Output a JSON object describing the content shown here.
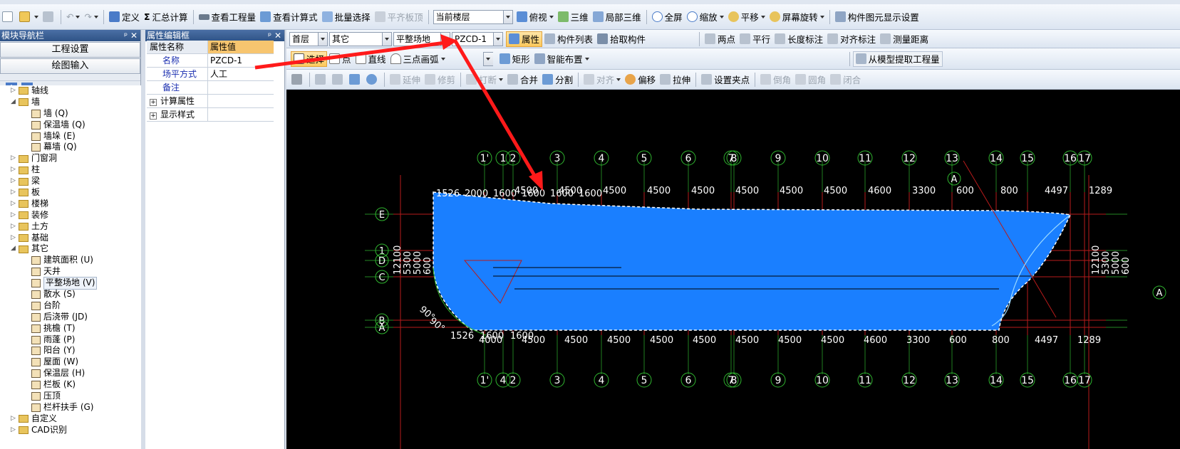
{
  "toolbar1": {
    "define": "定义",
    "summary_calc": "汇总计算",
    "view_quantity": "查看工程量",
    "view_formula": "查看计算式",
    "batch_select": "批量选择",
    "align_slab": "平齐板顶",
    "current_floor": "当前楼层",
    "top_view": "俯视",
    "three_d": "三维",
    "partial_3d": "局部三维",
    "full_screen": "全屏",
    "zoom": "缩放",
    "pan": "平移",
    "rotate_screen": "屏幕旋转",
    "display_settings": "构件图元显示设置"
  },
  "nav_panel": {
    "title": "模块导航栏",
    "project_settings": "工程设置",
    "drawing_input": "绘图输入",
    "tree": [
      {
        "label": "轴线",
        "level": 0,
        "expanded": false
      },
      {
        "label": "墙",
        "level": 0,
        "expanded": true
      },
      {
        "label": "墙 (Q)",
        "level": 1
      },
      {
        "label": "保温墙 (Q)",
        "level": 1
      },
      {
        "label": "墙垛 (E)",
        "level": 1
      },
      {
        "label": "幕墙 (Q)",
        "level": 1
      },
      {
        "label": "门窗洞",
        "level": 0,
        "expanded": false
      },
      {
        "label": "柱",
        "level": 0,
        "expanded": false
      },
      {
        "label": "梁",
        "level": 0,
        "expanded": false
      },
      {
        "label": "板",
        "level": 0,
        "expanded": false
      },
      {
        "label": "楼梯",
        "level": 0,
        "expanded": false
      },
      {
        "label": "装修",
        "level": 0,
        "expanded": false
      },
      {
        "label": "土方",
        "level": 0,
        "expanded": false
      },
      {
        "label": "基础",
        "level": 0,
        "expanded": false
      },
      {
        "label": "其它",
        "level": 0,
        "expanded": true
      },
      {
        "label": "建筑面积 (U)",
        "level": 1
      },
      {
        "label": "天井",
        "level": 1
      },
      {
        "label": "平整场地 (V)",
        "level": 1,
        "selected": true
      },
      {
        "label": "散水 (S)",
        "level": 1
      },
      {
        "label": "台阶",
        "level": 1
      },
      {
        "label": "后浇带 (JD)",
        "level": 1
      },
      {
        "label": "挑檐 (T)",
        "level": 1
      },
      {
        "label": "雨蓬 (P)",
        "level": 1
      },
      {
        "label": "阳台 (Y)",
        "level": 1
      },
      {
        "label": "屋面 (W)",
        "level": 1
      },
      {
        "label": "保温层 (H)",
        "level": 1
      },
      {
        "label": "栏板 (K)",
        "level": 1
      },
      {
        "label": "压顶",
        "level": 1
      },
      {
        "label": "栏杆扶手 (G)",
        "level": 1
      },
      {
        "label": "自定义",
        "level": 0,
        "expanded": false
      },
      {
        "label": "CAD识别",
        "level": 0,
        "expanded": false
      }
    ]
  },
  "prop_panel": {
    "title": "属性编辑框",
    "header_name": "属性名称",
    "header_value": "属性值",
    "rows": [
      {
        "name": "名称",
        "value": "PZCD-1",
        "blue": true
      },
      {
        "name": "场平方式",
        "value": "人工",
        "blue": true
      },
      {
        "name": "备注",
        "value": "",
        "blue": true
      },
      {
        "name": "计算属性",
        "value": "",
        "expand": true
      },
      {
        "name": "显示样式",
        "value": "",
        "expand": true
      }
    ]
  },
  "toolbar2": {
    "floor": "首层",
    "category": "其它",
    "component_type": "平整场地",
    "component_name": "PZCD-1",
    "properties": "属性",
    "component_list": "构件列表",
    "pick_component": "拾取构件",
    "two_points": "两点",
    "parallel": "平行",
    "length_mark": "长度标注",
    "align_mark": "对齐标注",
    "measure": "测量距离"
  },
  "toolbar3": {
    "select": "选择",
    "point": "点",
    "line": "直线",
    "arc3": "三点画弧",
    "rect": "矩形",
    "smart_place": "智能布置",
    "extract_qty": "从模型提取工程量"
  },
  "toolbar4": {
    "extend": "延伸",
    "trim": "修剪",
    "break": "打断",
    "merge": "合并",
    "split": "分割",
    "align": "对齐",
    "offset": "偏移",
    "stretch": "拉伸",
    "set_grip": "设置夹点",
    "chamfer": "倒角",
    "fillet": "圆角",
    "close": "闭合"
  },
  "drawing": {
    "axis_labels": [
      "1'",
      "1",
      "2",
      "3",
      "4",
      "5",
      "6",
      "7",
      "8",
      "9",
      "10",
      "11",
      "12",
      "13",
      "14",
      "15",
      "16",
      "17"
    ],
    "bottom_axis_labels": [
      "1'",
      "4",
      "2",
      "3",
      "4",
      "5",
      "6",
      "7",
      "8",
      "9",
      "10",
      "11",
      "12",
      "13",
      "14",
      "15",
      "16",
      "17"
    ],
    "row_labels": [
      "E",
      "1",
      "D",
      "C",
      "B",
      "A"
    ],
    "right_label": "A",
    "circle_a_label": "A",
    "top_dims": [
      "4500",
      "4500",
      "4500",
      "4500",
      "4500",
      "4500",
      "4500",
      "4500",
      "4600",
      "3300",
      "600",
      "800",
      "4497",
      "1289",
      "1526",
      "2000",
      "1600",
      "1600",
      "1600",
      "1600"
    ],
    "bottom_dims": [
      "4000",
      "4500",
      "4500",
      "4500",
      "4500",
      "4500",
      "4500",
      "4500",
      "4500",
      "4600",
      "3300",
      "600",
      "800",
      "4497",
      "1289",
      "1526",
      "1600",
      "1600"
    ],
    "vertical_dims": [
      "12100",
      "5300",
      "5000",
      "600"
    ],
    "angle_labels": [
      "90°",
      "90°"
    ],
    "fill_color": "#1a7fff",
    "grid_color": "#b81b1b",
    "axis_color": "#2fb52f",
    "arrow_color": "#ff1a1a"
  }
}
